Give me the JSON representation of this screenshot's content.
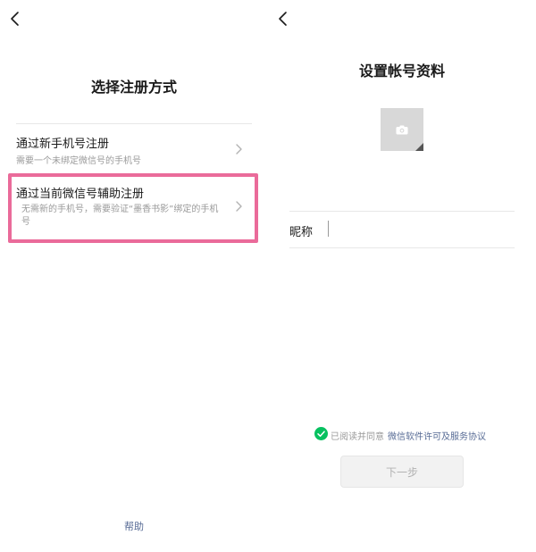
{
  "left": {
    "title": "选择注册方式",
    "options": [
      {
        "title": "通过新手机号注册",
        "description": "需要一个未绑定微信号的手机号"
      },
      {
        "title": "通过当前微信号辅助注册",
        "description": "无需新的手机号，需要验证“墨香书影”绑定的手机号"
      }
    ],
    "help": "帮助"
  },
  "right": {
    "title": "设置帐号资料",
    "nickname_label": "昵称",
    "nickname_value": "",
    "agree_text": "已阅读并同意",
    "agree_link": "微信软件许可及服务协议",
    "next_button": "下一步"
  },
  "colors": {
    "highlight": "#ea6b9a",
    "link": "#576b95",
    "check_green": "#07c160",
    "disabled_button_bg": "#f2f2f2"
  },
  "icons": {
    "back": "chevron-left-icon",
    "chevron": "chevron-right-icon",
    "camera": "camera-icon",
    "check": "check-circle-icon"
  }
}
